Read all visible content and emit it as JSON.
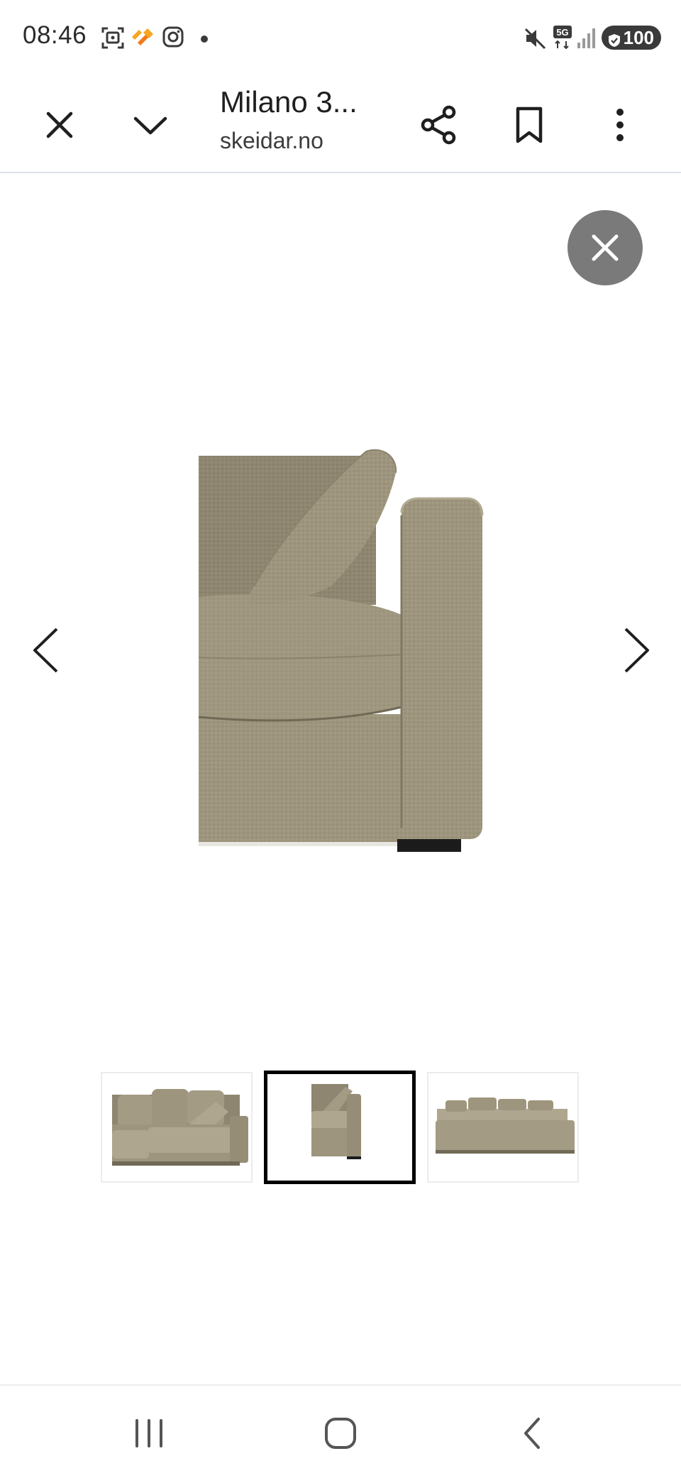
{
  "status_bar": {
    "time": "08:46",
    "icons": [
      "screenshot-icon",
      "app-icon",
      "instagram-icon",
      "notification-dot-icon",
      "mute-icon",
      "5g-icon",
      "signal-icon"
    ],
    "network": "5G",
    "battery": "100"
  },
  "toolbar": {
    "title": "Milano 3...",
    "domain": "skeidar.no",
    "icons": {
      "close": "close-icon",
      "collapse": "chevron-down-icon",
      "share": "share-icon",
      "bookmark": "bookmark-icon",
      "menu": "more-vert-icon"
    }
  },
  "viewer": {
    "close_icon": "close-icon",
    "prev_icon": "chevron-left-icon",
    "next_icon": "chevron-right-icon",
    "main_image": "sofa-corner-photo"
  },
  "thumbnails": {
    "items": [
      {
        "name": "sofa-front-view",
        "selected": false
      },
      {
        "name": "sofa-corner-view",
        "selected": true
      },
      {
        "name": "sofa-back-view",
        "selected": false
      }
    ]
  },
  "bottom_nav": {
    "recents_icon": "recent-apps-icon",
    "home_icon": "home-icon",
    "back_icon": "back-icon"
  },
  "colors": {
    "fabric": "#9d957d",
    "fabric_dark": "#7f7863",
    "fabric_light": "#aea68e",
    "close_circle": "#7a7a7a",
    "selected_border": "#000000"
  }
}
